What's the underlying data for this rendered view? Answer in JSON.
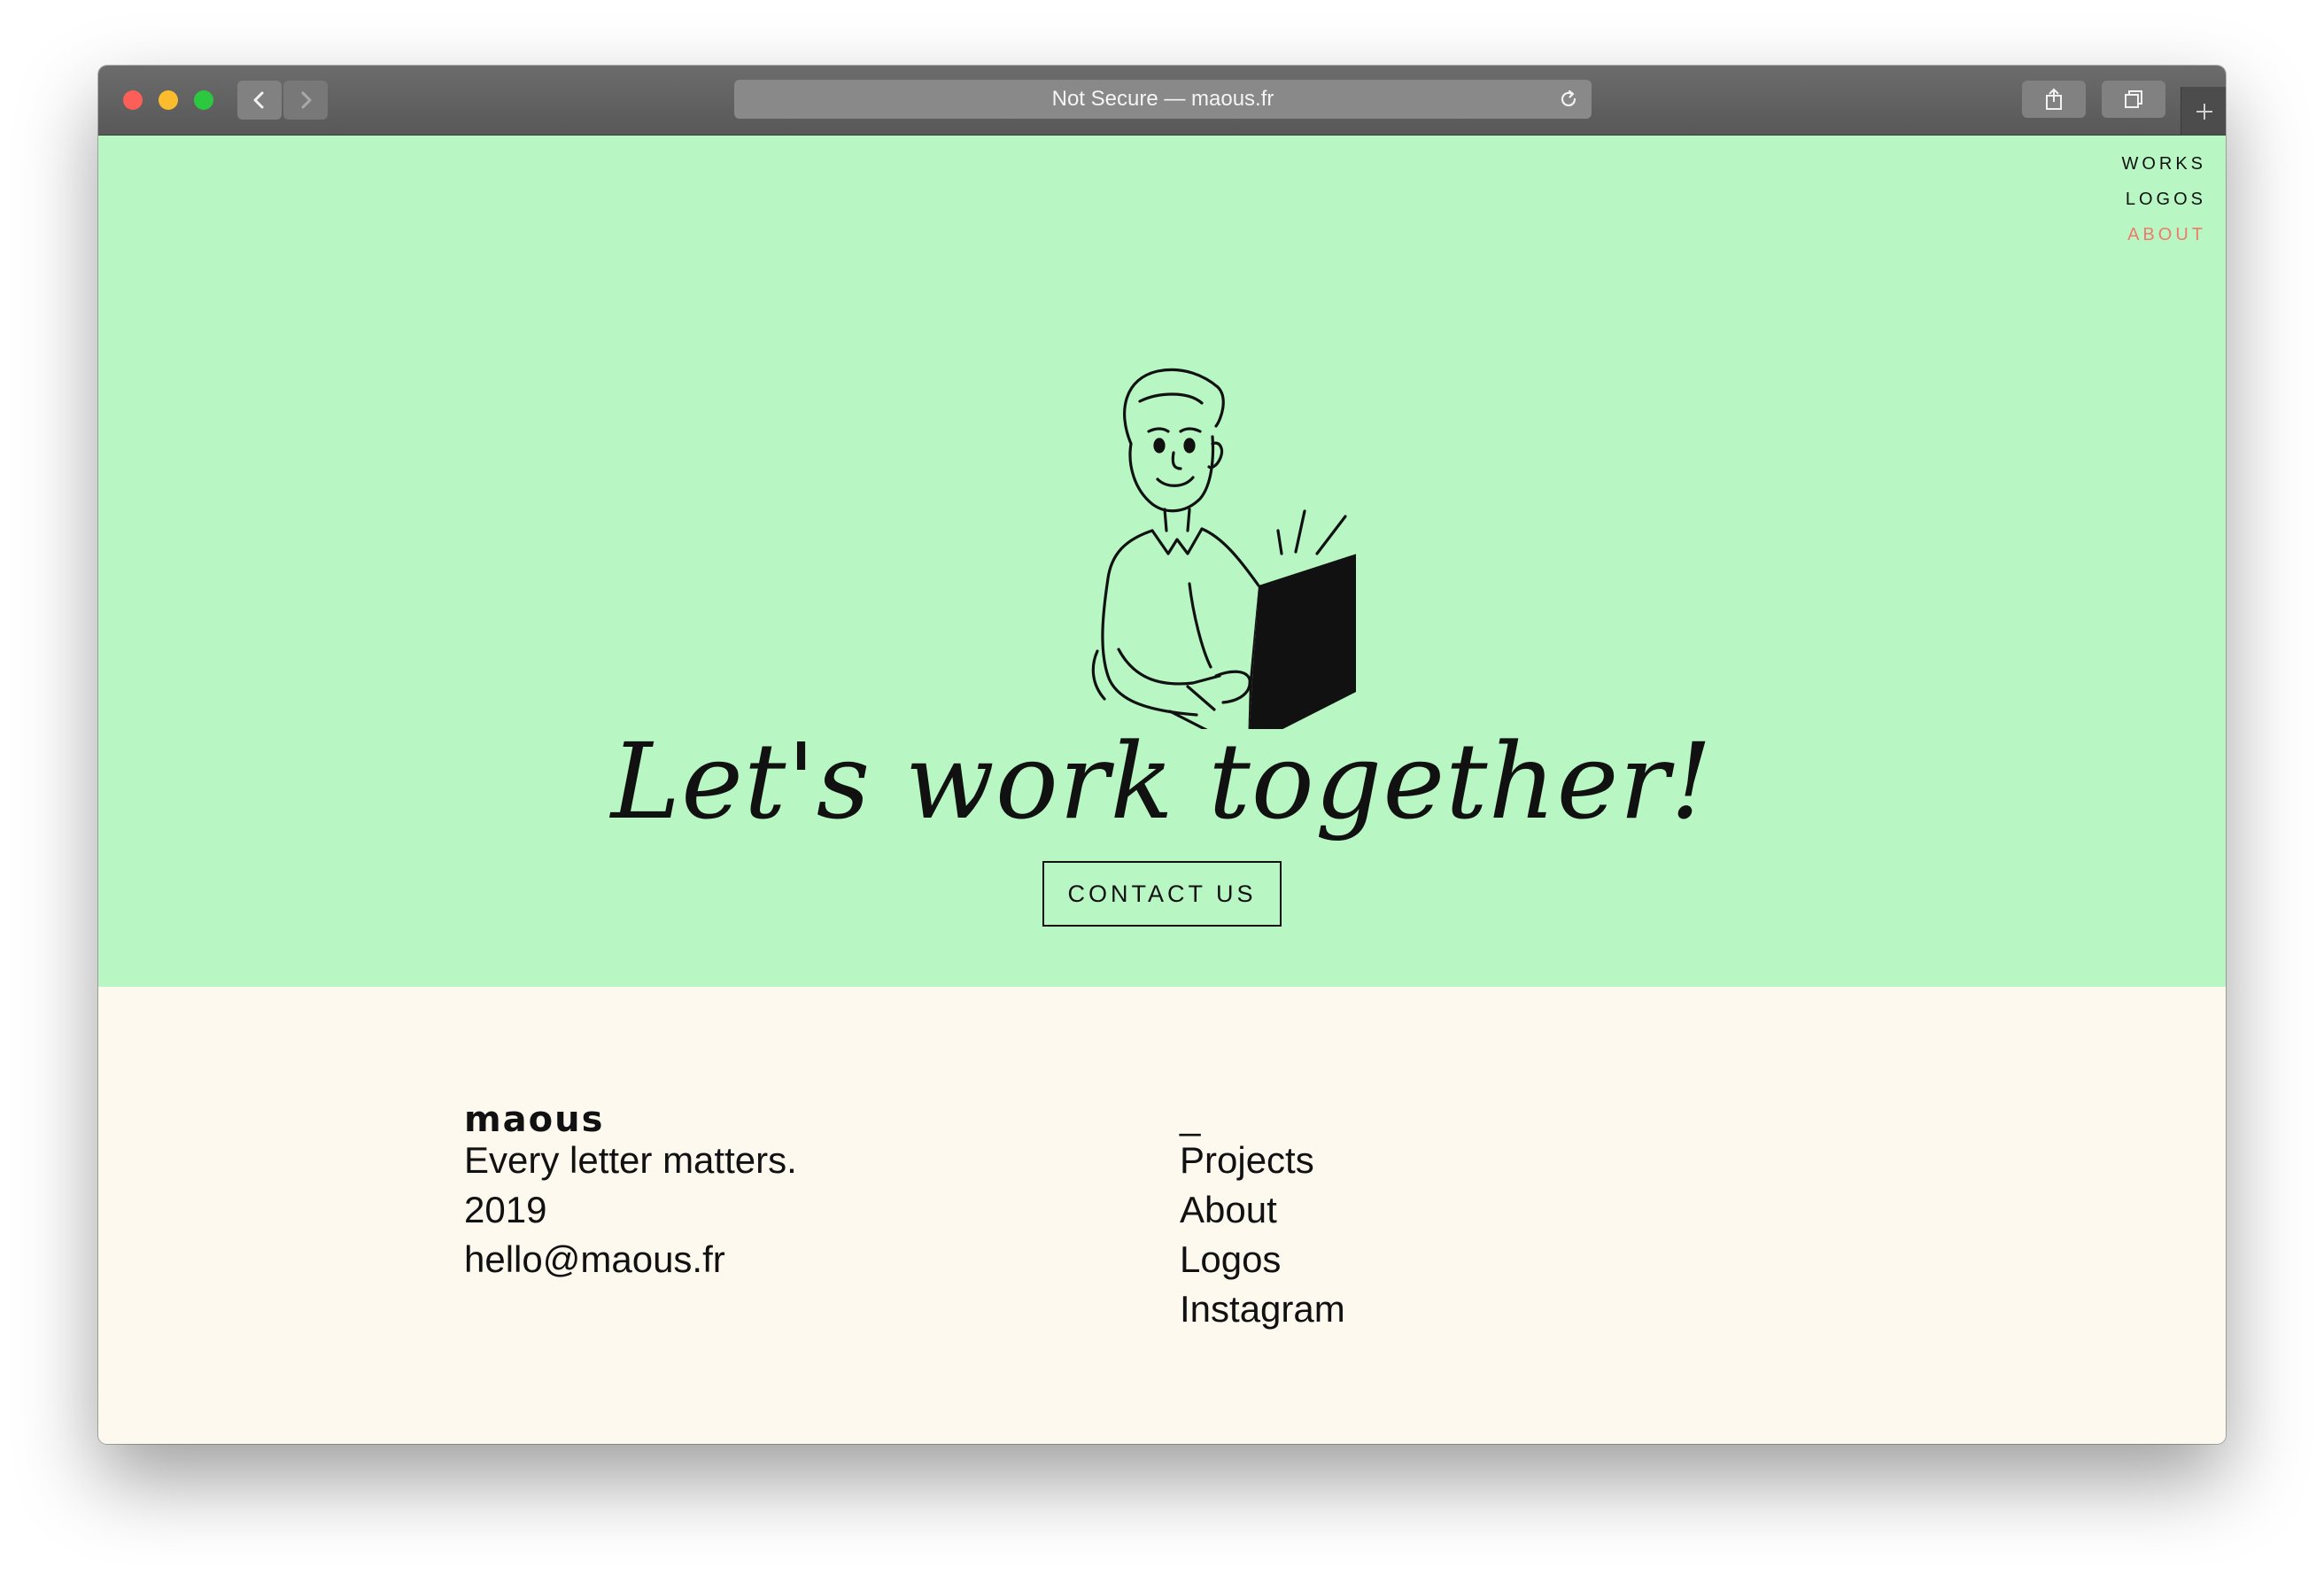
{
  "browser": {
    "address": "Not Secure — maous.fr"
  },
  "nav": {
    "items": [
      {
        "label": "WORKS"
      },
      {
        "label": "LOGOS"
      },
      {
        "label": "ABOUT"
      }
    ],
    "active_color": "#f07a6c"
  },
  "hero": {
    "background": "#b8f7c3",
    "headline": "Let's work together!",
    "cta_label": "CONTACT US",
    "illustration": "person-with-laptop-icon"
  },
  "footer": {
    "background": "#fdf9ef",
    "brand": "maous",
    "tagline": "Every letter matters.",
    "year": "2019",
    "email": "hello@maous.fr",
    "dash": "_",
    "links": [
      {
        "label": "Projects"
      },
      {
        "label": "About"
      },
      {
        "label": "Logos"
      },
      {
        "label": "Instagram"
      }
    ]
  }
}
